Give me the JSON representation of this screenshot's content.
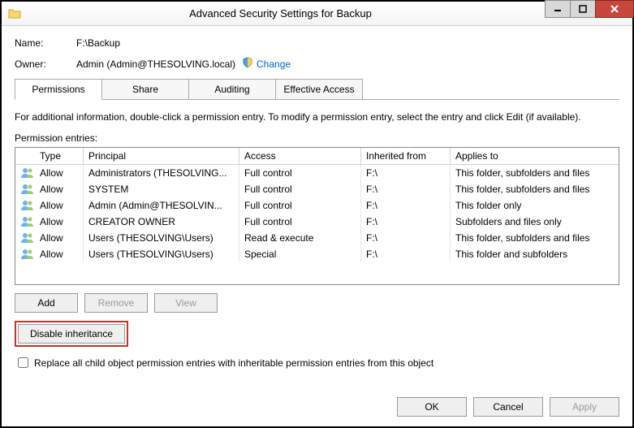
{
  "window": {
    "title": "Advanced Security Settings for Backup"
  },
  "header": {
    "name_label": "Name:",
    "name_value": "F:\\Backup",
    "owner_label": "Owner:",
    "owner_value": "Admin (Admin@THESOLVING.local)",
    "change_link": "Change"
  },
  "tabs": {
    "permissions": "Permissions",
    "share": "Share",
    "auditing": "Auditing",
    "effective": "Effective Access"
  },
  "desc": "For additional information, double-click a permission entry. To modify a permission entry, select the entry and click Edit (if available).",
  "entries_label": "Permission entries:",
  "columns": {
    "type": "Type",
    "principal": "Principal",
    "access": "Access",
    "inherited": "Inherited from",
    "applies": "Applies to"
  },
  "entries": [
    {
      "type": "Allow",
      "principal": "Administrators (THESOLVING...",
      "access": "Full control",
      "inherited": "F:\\",
      "applies": "This folder, subfolders and files"
    },
    {
      "type": "Allow",
      "principal": "SYSTEM",
      "access": "Full control",
      "inherited": "F:\\",
      "applies": "This folder, subfolders and files"
    },
    {
      "type": "Allow",
      "principal": "Admin (Admin@THESOLVIN...",
      "access": "Full control",
      "inherited": "F:\\",
      "applies": "This folder only"
    },
    {
      "type": "Allow",
      "principal": "CREATOR OWNER",
      "access": "Full control",
      "inherited": "F:\\",
      "applies": "Subfolders and files only"
    },
    {
      "type": "Allow",
      "principal": "Users (THESOLVING\\Users)",
      "access": "Read & execute",
      "inherited": "F:\\",
      "applies": "This folder, subfolders and files"
    },
    {
      "type": "Allow",
      "principal": "Users (THESOLVING\\Users)",
      "access": "Special",
      "inherited": "F:\\",
      "applies": "This folder and subfolders"
    }
  ],
  "buttons": {
    "add": "Add",
    "remove": "Remove",
    "view": "View",
    "disable_inheritance": "Disable inheritance",
    "ok": "OK",
    "cancel": "Cancel",
    "apply": "Apply"
  },
  "checkbox_label": "Replace all child object permission entries with inheritable permission entries from this object"
}
